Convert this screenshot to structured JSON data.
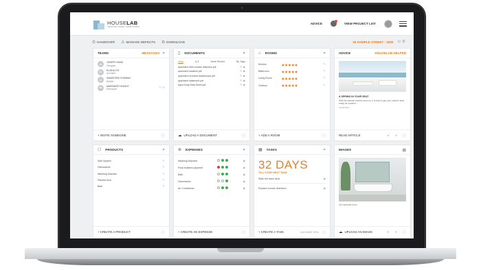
{
  "header": {
    "logo_name_a": "HOUSE",
    "logo_name_b": "LAB",
    "logo_tag": "SMARTER HOMES, MADE SIMPLE",
    "advice": "ADVICE",
    "project_list": "VIEW PROJECT LIST"
  },
  "subbar": {
    "handover": "HANDOVER",
    "manage_defects": "MANAGE DEFECTS",
    "download": "DOWNLOAD",
    "address": "36 SAMPLE STREET - 2000"
  },
  "teams": {
    "title": "TEAMS",
    "link": "MESSAGES",
    "members": [
      {
        "initials": "JS",
        "name": "JOSEPH SHAN",
        "role": "Designer"
      },
      {
        "initials": "EO",
        "name": "ELISHA O'S",
        "role": "Architect"
      },
      {
        "initials": "ST",
        "name": "SANDFORD FLEMING",
        "role": "Builder"
      },
      {
        "initials": "MK",
        "name": "MARGARET KNIGHT",
        "role": "Developer"
      }
    ],
    "footer": "+ INVITE SOMEONE"
  },
  "documents": {
    "title": "DOCUMENTS",
    "tabs": [
      "View",
      "A-Z",
      "Most Recent",
      "By Tags"
    ],
    "items": [
      "apartment 360o-smoke detectors.pdf",
      "apartment baseline.pdf",
      "apartment received switchboard.pdf",
      "apartment statement.pdf",
      "Aqua Soap Data Sheet.pdf"
    ],
    "footer": "UPLOAD A DOCUMENT"
  },
  "rooms": {
    "title": "ROOMS",
    "items": [
      "Kitchen",
      "Bathroom",
      "Living Room",
      "Outdoor"
    ],
    "footer": "+ ADD A ROOM"
  },
  "advice": {
    "title": "ADVICE",
    "link": "HOUSELAB HELPER",
    "article_title": "A SPRING IN YOUR SEAT",
    "article_text": "With the warmer months upon us, it is time to get your outdoor area ready for summer...",
    "article_date": "04/09/2018",
    "footer": "READ ARTICLE"
  },
  "products": {
    "title": "PRODUCTS",
    "items": [
      "Split System",
      "Dishwasher",
      "Washing Machine",
      "Painted door",
      "Bath"
    ],
    "footer": "+ CREATE A PRODUCT"
  },
  "expenses": {
    "title": "EXPENSES",
    "items": [
      {
        "name": "Washing Machine",
        "status": [
          "o",
          "g",
          "g"
        ]
      },
      {
        "name": "Final builders payment",
        "status": [
          "r",
          "g",
          "g"
        ]
      },
      {
        "name": "Bath",
        "status": [
          "o",
          "g",
          "g"
        ]
      },
      {
        "name": "Dishwasher",
        "status": [
          "o",
          "o",
          "g"
        ]
      },
      {
        "name": "Air Conditioner",
        "status": [
          "o",
          "g",
          "g"
        ]
      }
    ],
    "footer": "+ CREATE AN EXPENSE"
  },
  "tasks": {
    "title": "TASKS",
    "big": "32 DAYS",
    "till": "TILL YOUR NEXT TASK",
    "items": [
      "Stain the back deck",
      "Replace smoke detectors"
    ],
    "footer": "+ CREATE A TASK",
    "calendar": "CALENDAR VIEW"
  },
  "images": {
    "title": "IMAGES",
    "caption": "Our favourite room",
    "footer": "UPLOAD AN IMAGE"
  },
  "colors": {
    "accent": "#e67e22",
    "green": "#35b34a",
    "red": "#e53935"
  }
}
